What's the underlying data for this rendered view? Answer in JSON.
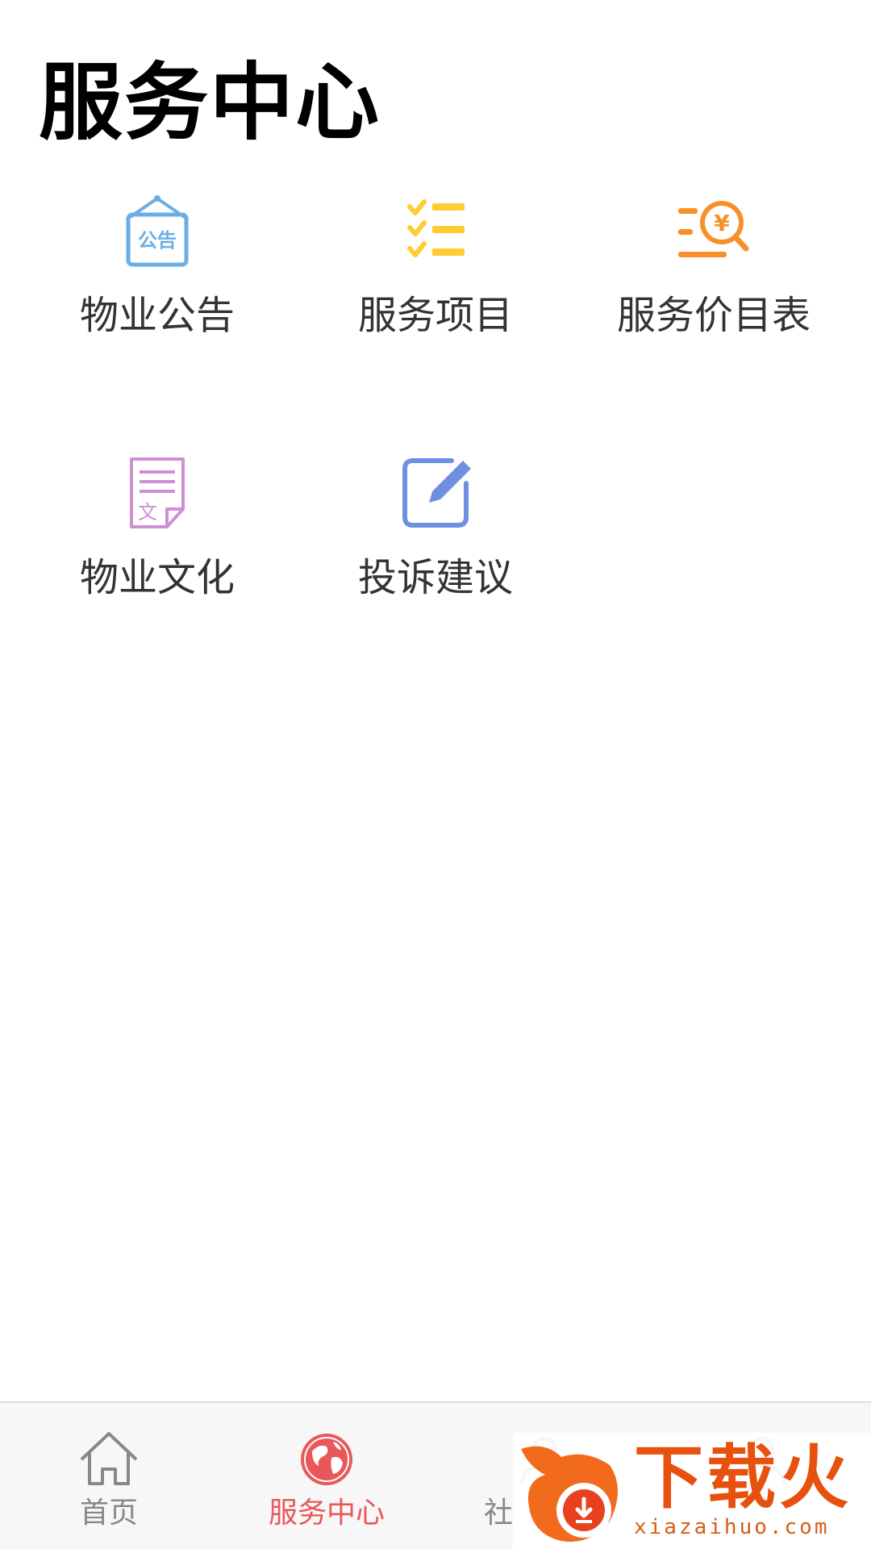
{
  "header": {
    "title": "服务中心"
  },
  "services": [
    {
      "label": "物业公告",
      "icon": "notice-board-icon",
      "icon_text": "公告",
      "color": "#6aaee6"
    },
    {
      "label": "服务项目",
      "icon": "checklist-icon",
      "color": "#ffcc33"
    },
    {
      "label": "服务价目表",
      "icon": "price-search-icon",
      "icon_text": "¥",
      "color": "#f8902a"
    },
    {
      "label": "物业文化",
      "icon": "document-icon",
      "icon_text": "文",
      "color": "#cf8fd4"
    },
    {
      "label": "投诉建议",
      "icon": "edit-icon",
      "color": "#6f8fe0"
    }
  ],
  "tab_bar": {
    "items": [
      {
        "label": "首页",
        "icon": "home-icon",
        "active": false
      },
      {
        "label": "服务中心",
        "icon": "globe-icon",
        "active": true
      },
      {
        "label": "社",
        "icon": "community-icon",
        "active": false
      },
      {
        "label": "",
        "icon": "profile-icon",
        "active": false
      }
    ],
    "active_color": "#e8585a",
    "inactive_color": "#888888"
  },
  "watermark": {
    "text": "下载火",
    "url": "xiazaihuo.com"
  }
}
